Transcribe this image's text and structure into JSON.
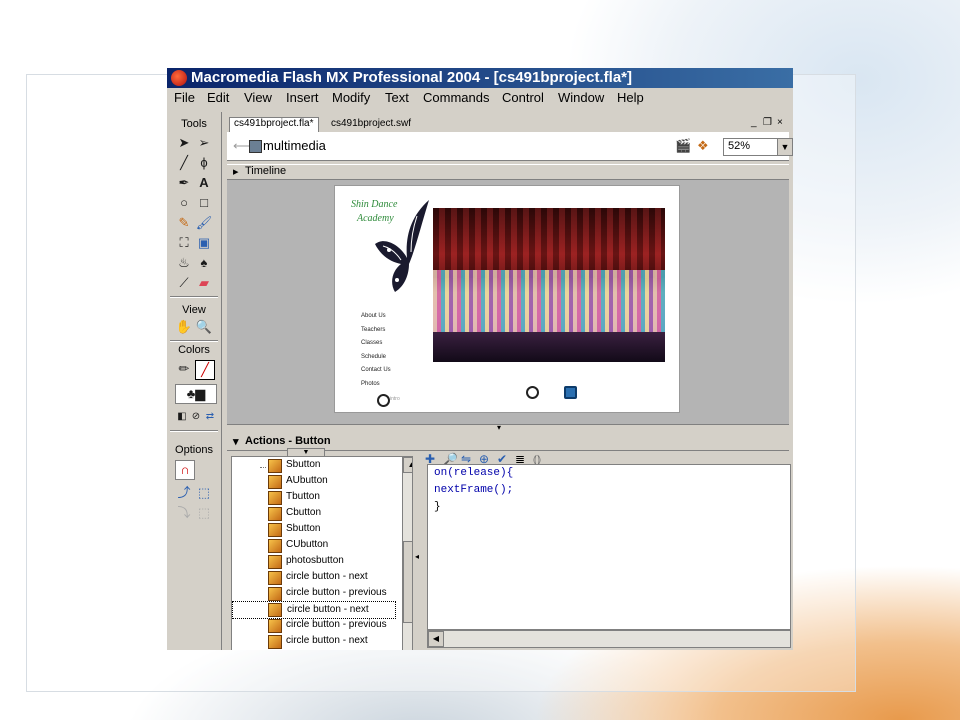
{
  "window": {
    "title": "Macromedia Flash MX Professional 2004 - [cs491bproject.fla*]"
  },
  "menu": [
    "File",
    "Edit",
    "View",
    "Insert",
    "Modify",
    "Text",
    "Commands",
    "Control",
    "Window",
    "Help"
  ],
  "tools_panel": {
    "title": "Tools",
    "view_label": "View",
    "colors_label": "Colors",
    "options_label": "Options",
    "icons": [
      "arrow-icon",
      "subselect-icon",
      "line-icon",
      "lasso-icon",
      "pen-icon",
      "text-icon",
      "oval-icon",
      "rectangle-icon",
      "pencil-icon",
      "brush-icon",
      "free-transform-icon",
      "fill-transform-icon",
      "ink-bottle-icon",
      "paint-bucket-icon",
      "eyedropper-icon",
      "eraser-icon",
      "hand-icon",
      "zoom-icon"
    ]
  },
  "document": {
    "tabs": [
      {
        "label": "cs491bproject.fla*",
        "active": true
      },
      {
        "label": "cs491bproject.swf",
        "active": false
      }
    ],
    "window_controls": [
      "_",
      "❐",
      "×"
    ],
    "scene": "multimedia",
    "zoom": "52%",
    "timeline_label": "Timeline"
  },
  "stage": {
    "brand_line1": "Shin Dance",
    "brand_line2": "Academy",
    "nav_links": [
      "About Us",
      "Teachers",
      "Classes",
      "Schedule",
      "Contact Us",
      "Photos"
    ],
    "small_label": "intro"
  },
  "actions": {
    "panel_title": "Actions - Button",
    "list_items": [
      {
        "label": "Sbutton",
        "selected": false
      },
      {
        "label": "AUbutton",
        "selected": false
      },
      {
        "label": "Tbutton",
        "selected": false
      },
      {
        "label": "Cbutton",
        "selected": false
      },
      {
        "label": "Sbutton",
        "selected": false
      },
      {
        "label": "CUbutton",
        "selected": false
      },
      {
        "label": "photosbutton",
        "selected": false
      },
      {
        "label": "circle button - next",
        "selected": false
      },
      {
        "label": "circle button - previous",
        "selected": false
      },
      {
        "label": "circle button - next",
        "selected": true
      },
      {
        "label": "circle button - previous",
        "selected": false
      },
      {
        "label": "circle button - next",
        "selected": false
      }
    ],
    "code_lines": [
      "on(release){",
      "nextFrame();",
      "}"
    ]
  },
  "colors": {
    "title_gradient_start": "#0a246a",
    "title_gradient_end": "#3a6ea5",
    "chrome": "#d4d0c8",
    "code": "#0000aa"
  }
}
